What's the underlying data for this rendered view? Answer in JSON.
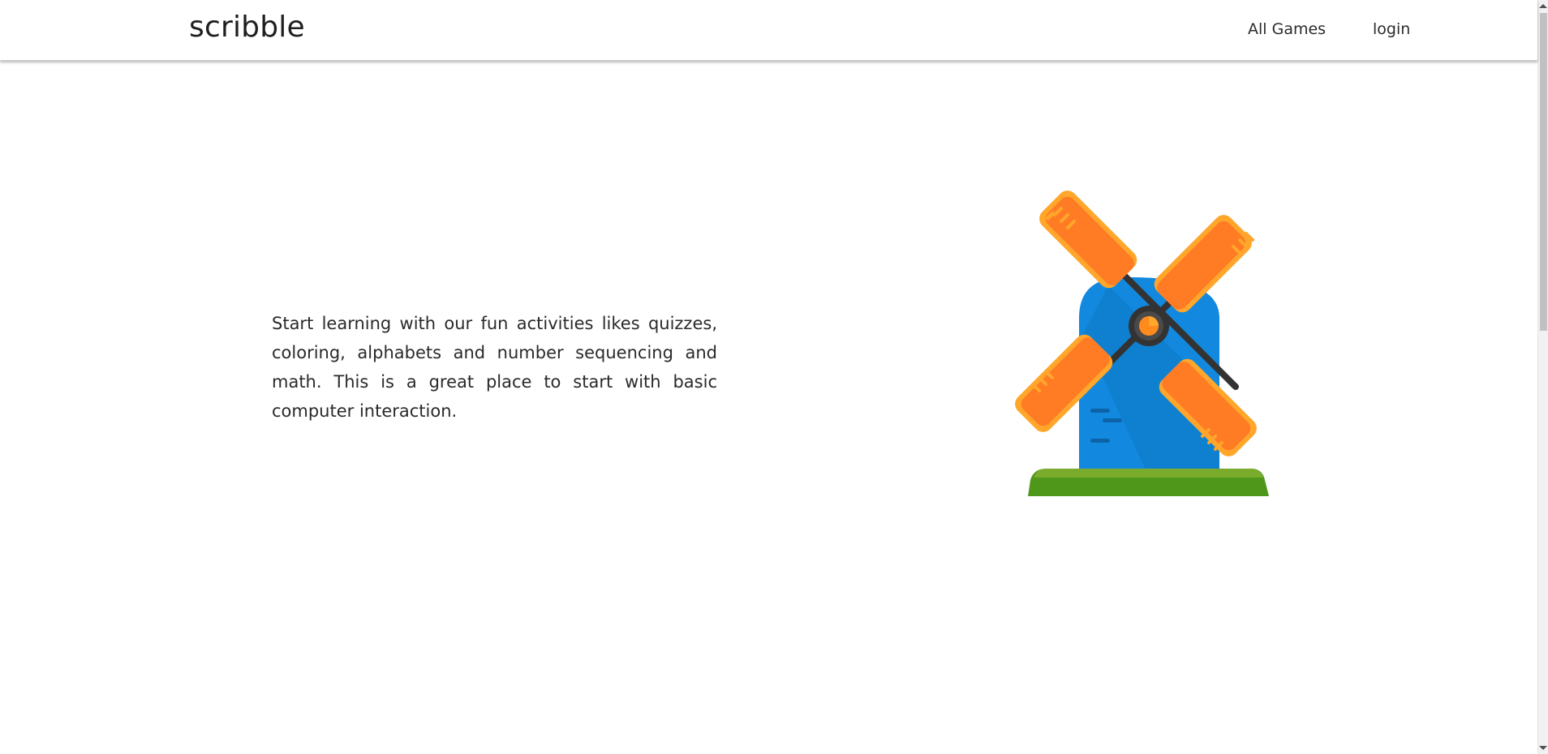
{
  "navbar": {
    "brand": "scribble",
    "links": [
      {
        "label": "All Games"
      },
      {
        "label": "login"
      }
    ]
  },
  "main": {
    "intro_text": "Start learning with our fun activities likes quizzes, coloring, alphabets and number sequencing and math. This is a great place to start with basic computer interaction."
  },
  "illustration": {
    "icon": "windmill-icon",
    "colors": {
      "tower": "#1289DE",
      "tower_shade": "#0B6FB8",
      "sail": "#FF7C25",
      "sail_trim": "#FFA62B",
      "hub": "#333333",
      "hub_center": "#FF8A1E",
      "ground_top": "#7AAB2D",
      "ground_bottom": "#4F971A"
    }
  }
}
